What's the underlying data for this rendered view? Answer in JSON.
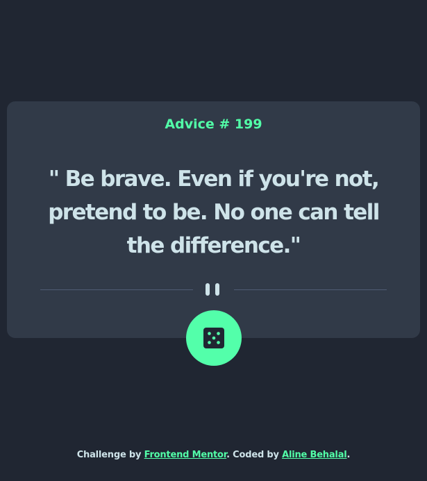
{
  "card": {
    "advice_label": "Advice # 199",
    "quote": "\" Be brave. Even if you're not, pretend to be. No one can tell the difference.\""
  },
  "footer": {
    "challenge_prefix": "Challenge by",
    "challenge_link": "Frontend Mentor",
    "coded_prefix": ". Coded by",
    "coded_link": "Aline Behalal",
    "suffix": "."
  },
  "icons": {
    "divider": "pause-icon",
    "button": "dice-icon"
  },
  "colors": {
    "background": "#202632",
    "card": "#313a48",
    "accent": "#52ffa8",
    "text": "#cee3e9",
    "divider": "#4f5d74"
  }
}
